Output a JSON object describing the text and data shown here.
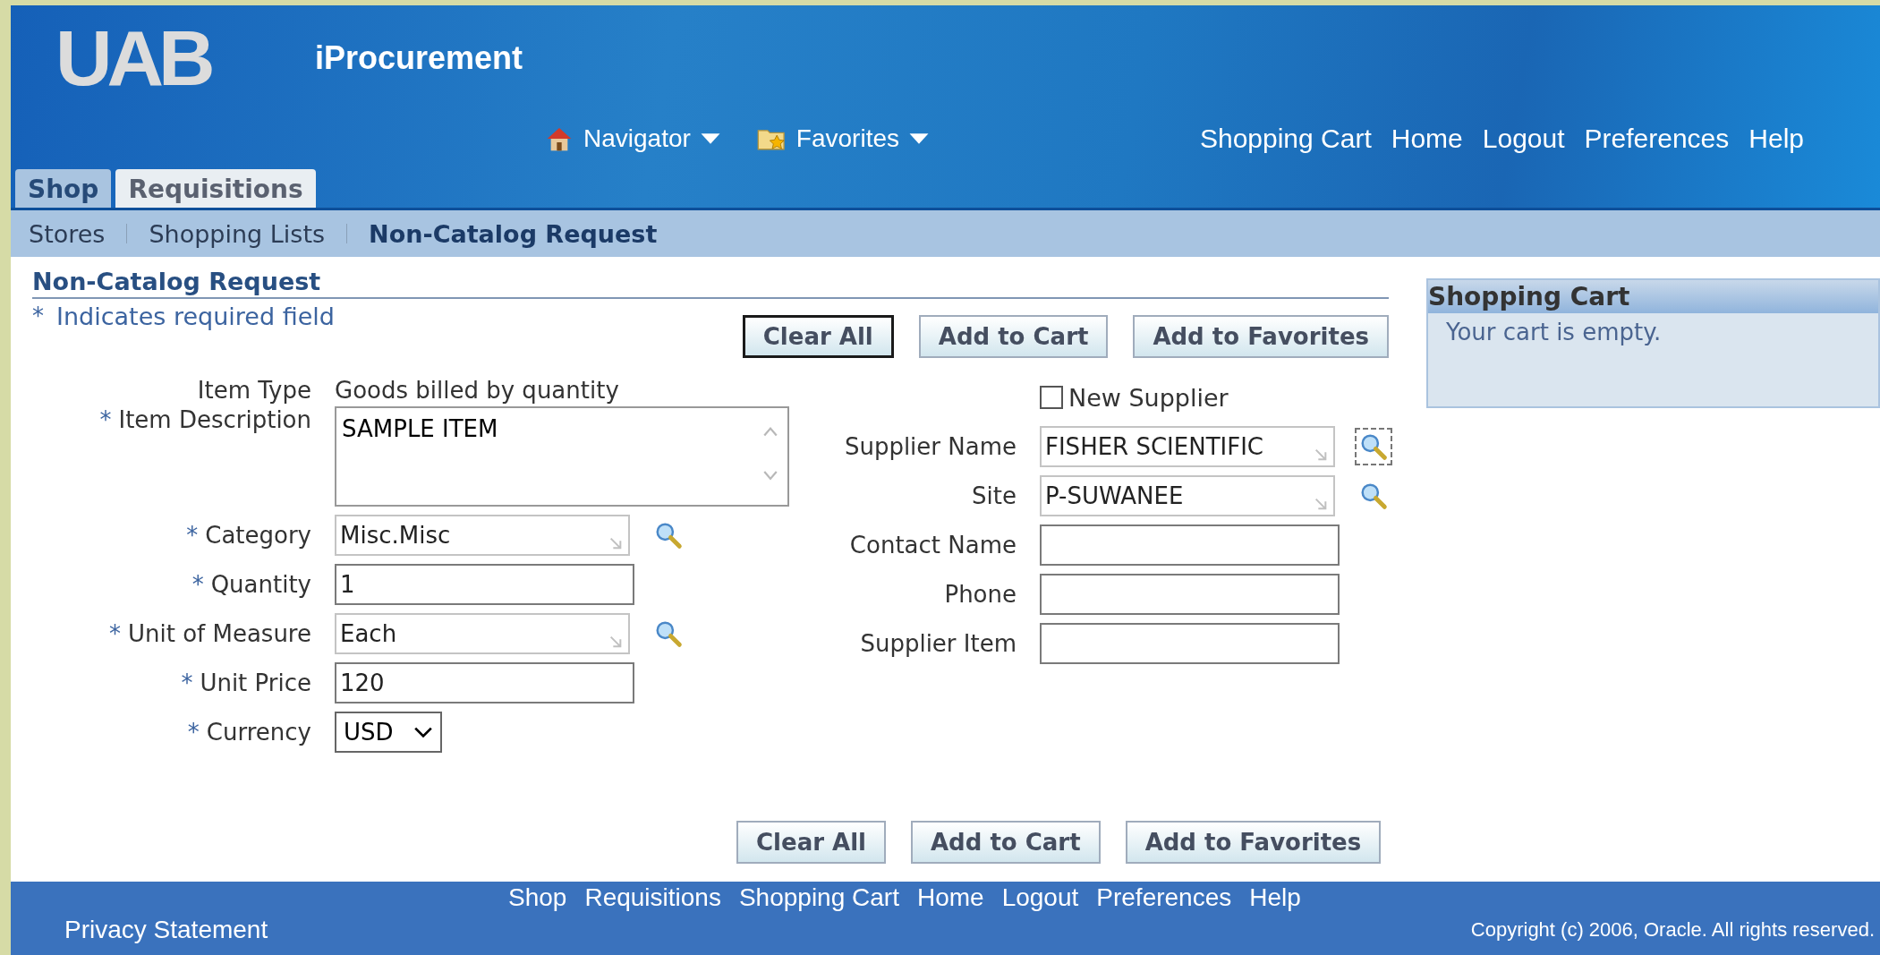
{
  "header": {
    "logo": "UAB",
    "app_title": "iProcurement",
    "menus": [
      {
        "label": "Navigator"
      },
      {
        "label": "Favorites"
      }
    ],
    "global_links": [
      "Shopping Cart",
      "Home",
      "Logout",
      "Preferences",
      "Help"
    ]
  },
  "tabs": [
    {
      "label": "Shop",
      "selected": true
    },
    {
      "label": "Requisitions",
      "selected": false
    }
  ],
  "subtabs": [
    {
      "label": "Stores",
      "selected": false
    },
    {
      "label": "Shopping Lists",
      "selected": false
    },
    {
      "label": "Non-Catalog Request",
      "selected": true
    }
  ],
  "page_title": "Non-Catalog Request",
  "required_note": {
    "mark": "*",
    "text": "Indicates required field"
  },
  "top_buttons": [
    {
      "label": "Clear All",
      "focused": true
    },
    {
      "label": "Add to Cart",
      "focused": false
    },
    {
      "label": "Add to Favorites",
      "focused": false
    }
  ],
  "left_fields": [
    {
      "kind": "display",
      "label": "Item Type",
      "value": "Goods billed by quantity"
    },
    {
      "kind": "textarea",
      "mark": "*",
      "label": "Item Description",
      "value": "SAMPLE ITEM"
    },
    {
      "kind": "lov",
      "mark": "*",
      "label": "Category",
      "value": "Misc.Misc",
      "lookup_focused": false
    },
    {
      "kind": "text",
      "mark": "*",
      "label": "Quantity",
      "value": "1"
    },
    {
      "kind": "lov",
      "mark": "*",
      "label": "Unit of Measure",
      "value": "Each",
      "lookup_focused": false
    },
    {
      "kind": "text",
      "mark": "*",
      "label": "Unit Price",
      "value": "120"
    },
    {
      "kind": "select",
      "mark": "*",
      "label": "Currency",
      "value": "USD"
    }
  ],
  "new_supplier": {
    "label": "New Supplier",
    "checked": false
  },
  "right_fields": [
    {
      "kind": "lov",
      "label": "Supplier Name",
      "value": "FISHER SCIENTIFIC",
      "lookup_focused": true
    },
    {
      "kind": "lov",
      "label": "Site",
      "value": "P-SUWANEE",
      "lookup_focused": false
    },
    {
      "kind": "text",
      "label": "Contact Name"
    },
    {
      "kind": "text",
      "label": "Phone"
    },
    {
      "kind": "text",
      "label": "Supplier Item"
    }
  ],
  "bottom_buttons": [
    {
      "label": "Clear All",
      "focused": false
    },
    {
      "label": "Add to Cart",
      "focused": false
    },
    {
      "label": "Add to Favorites",
      "focused": false
    }
  ],
  "cart": {
    "title": "Shopping Cart",
    "message": "Your cart is empty."
  },
  "footer": {
    "links": [
      "Shop",
      "Requisitions",
      "Shopping Cart",
      "Home",
      "Logout",
      "Preferences",
      "Help"
    ],
    "privacy": "Privacy Statement",
    "copyright": "Copyright (c) 2006, Oracle. All rights reserved."
  }
}
